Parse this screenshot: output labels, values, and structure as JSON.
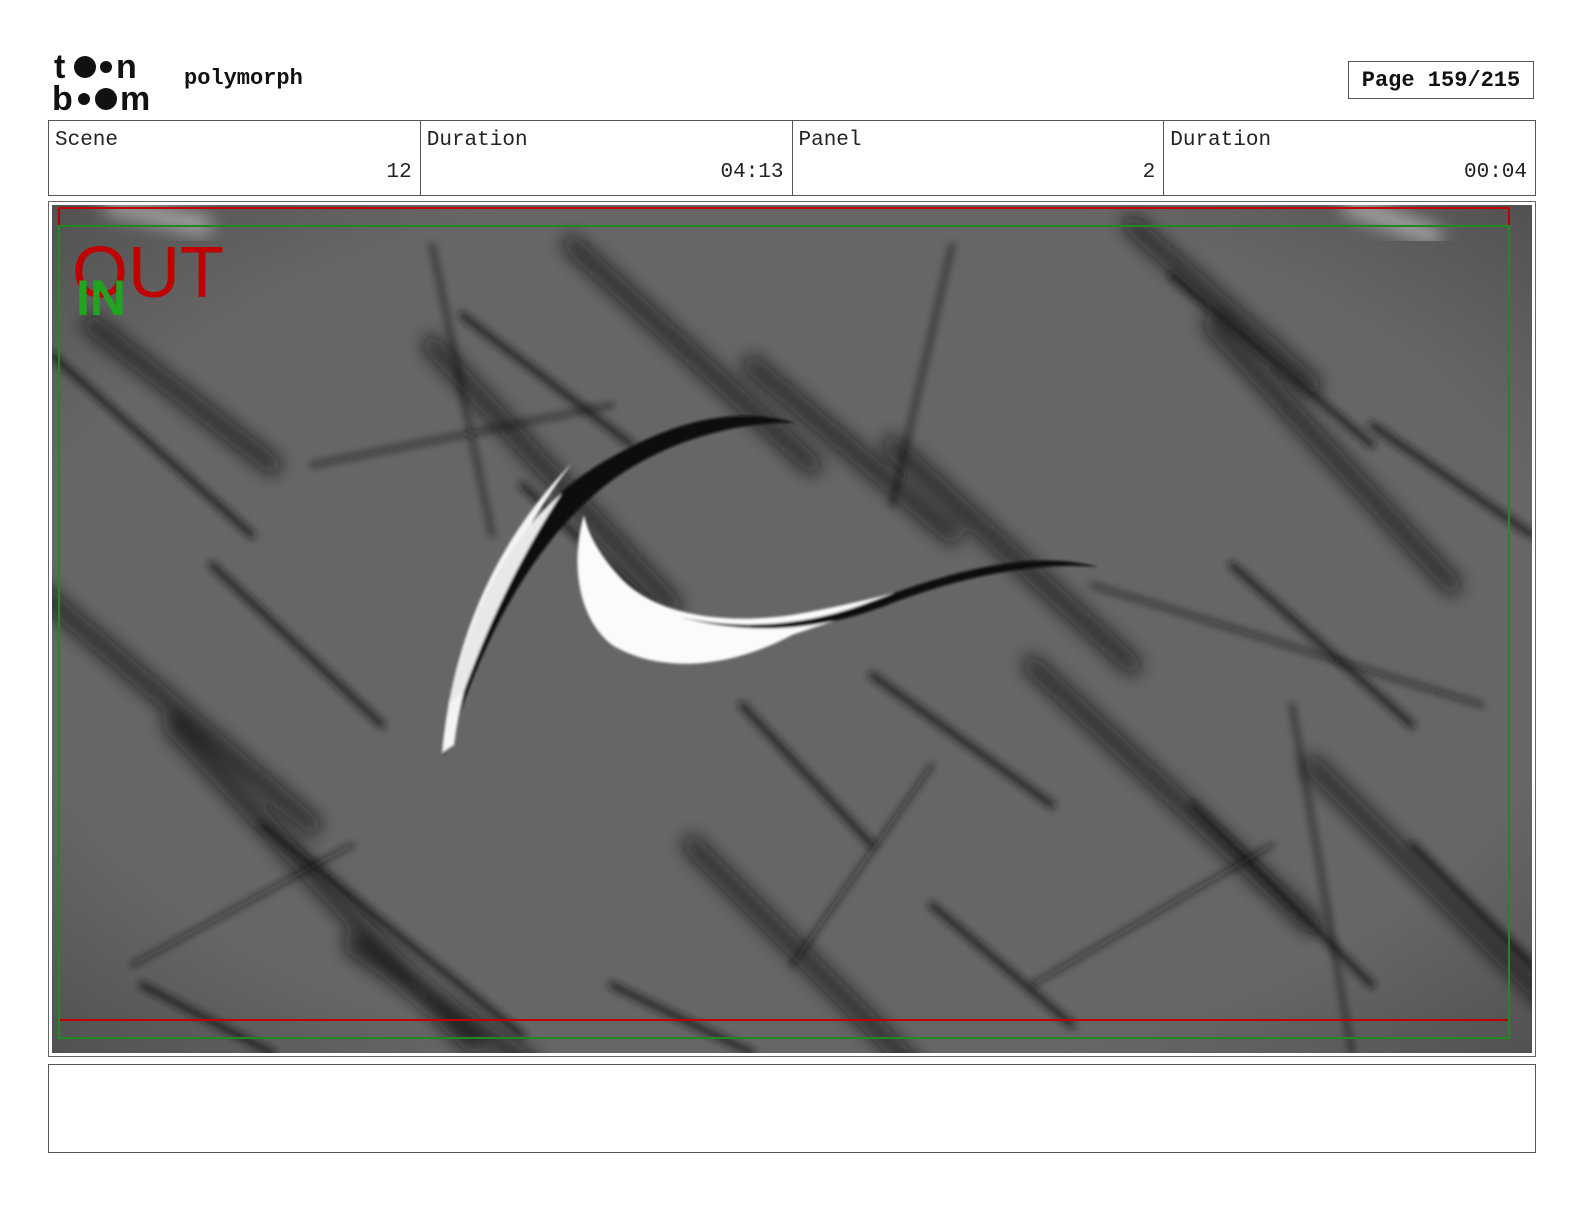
{
  "header": {
    "logo_text": "toonboom",
    "project_name": "polymorph",
    "page_label": "Page 159/215"
  },
  "info": {
    "scene_label": "Scene",
    "scene_value": "12",
    "scene_duration_label": "Duration",
    "scene_duration_value": "04:13",
    "panel_label": "Panel",
    "panel_value": "2",
    "panel_duration_label": "Duration",
    "panel_duration_value": "00:04"
  },
  "panel": {
    "out_label": "OUT",
    "in_label": "IN",
    "out_color": "#c00000",
    "in_color": "#1fa51f",
    "background_color": "#666666"
  },
  "notes": {
    "text": ""
  }
}
